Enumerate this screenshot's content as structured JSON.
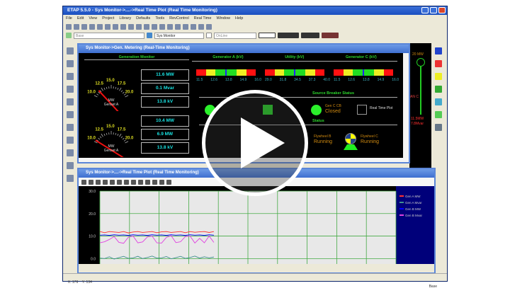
{
  "app": {
    "title": "ETAP 5.5.0 - Sys Monitor->....->Real Time Plot (Real Time Monitoring)",
    "menu": [
      "File",
      "Edit",
      "View",
      "Project",
      "Library",
      "Defaults",
      "Tools",
      "RevControl",
      "Real Time",
      "Window",
      "Help"
    ],
    "combos": {
      "revision": "Base",
      "study": "Sys Monitor",
      "mode": "OnLine"
    }
  },
  "metering": {
    "title": "Sys Monitor->Gen. Metering (Real-Time Monitoring)",
    "generation_monitor": "Generation Monitor",
    "gauges": [
      {
        "scale": [
          "10.0",
          "12.5",
          "15.0",
          "17.5",
          "20.0"
        ],
        "unit": "MW",
        "label": "Genset A",
        "value": 11.6
      },
      {
        "scale": [
          "10.0",
          "12.5",
          "15.0",
          "17.5",
          "20.0"
        ],
        "unit": "MW",
        "label": "Genset A",
        "value": 10.4
      }
    ],
    "readouts": [
      "11.6  MW",
      "0.1  Mvar",
      "13.8  kV",
      "10.4  MW",
      "6.9  MW",
      "13.8  kV"
    ],
    "bars": [
      {
        "title": "Generator A (kV)",
        "ticks": [
          "11.5",
          "12.6",
          "13.8",
          "14.9",
          "16.0"
        ]
      },
      {
        "title": "Utility (kV)",
        "ticks": [
          "29.0",
          "31.8",
          "34.5",
          "37.3",
          "40.0"
        ]
      },
      {
        "title": "Generator C (kV)",
        "ticks": [
          "11.5",
          "12.6",
          "13.8",
          "14.9",
          "16.0"
        ]
      }
    ],
    "breaker_status_title": "Source Breaker Status",
    "breaker_c": {
      "label": "Gen C CB",
      "state": "Closed"
    },
    "realtime_plot_label": "Real Time Plot",
    "status_title": "Status",
    "flywheel_b": {
      "label": "Flywheel B",
      "state": "Running"
    },
    "flywheel_c": {
      "label": "Flywheel C",
      "state": "Running"
    }
  },
  "schematic": {
    "gen": "20 MW",
    "gen_label": "Gen",
    "bus": "AN C",
    "mw": "11.5MW",
    "mvar": "7.8Mvar"
  },
  "plot": {
    "title": "Sys Monitor->....->Real Time Plot (Real Time Monitoring)",
    "chart_data": {
      "type": "line",
      "ylim": [
        -5,
        30
      ],
      "yticks": [
        "30.0",
        "20.0",
        "10.0",
        "0.0"
      ],
      "grid": true,
      "legend": "right",
      "series": [
        {
          "name": "Gen A MW",
          "color": "#ff3030",
          "values": [
            12,
            11.5,
            12,
            11.8,
            11.6,
            12,
            11.4,
            11.8,
            12,
            11.6,
            11.8,
            12,
            11.5,
            11.9,
            12,
            11.6,
            11.8,
            12,
            11.5,
            12,
            11.7,
            11.9,
            12,
            11.6,
            12
          ]
        },
        {
          "name": "Gen A Mvar",
          "color": "#409090",
          "values": [
            0.2,
            0,
            0.8,
            -0.2,
            0.4,
            1,
            0.1,
            0.3,
            1,
            0,
            0.5,
            1.1,
            0.2,
            0.3,
            0.9,
            -0.1,
            0.4,
            1,
            0.1,
            0.5,
            1.1,
            0.2,
            0.8,
            0.3,
            0.7
          ]
        },
        {
          "name": "Gen B MW",
          "color": "#0000ff",
          "values": [
            10.4,
            10.5,
            10.3,
            10.6,
            10.4,
            10.5,
            10.3,
            10.6,
            10.4,
            10.5,
            10.3,
            10.6,
            10.4,
            10.5,
            10.3,
            10.6,
            10.4,
            10.5,
            10.3,
            10.6,
            10.4,
            10.5,
            10.3,
            10.6,
            10.4
          ]
        },
        {
          "name": "Gen B Mvar",
          "color": "#e040e0",
          "values": [
            7,
            7.5,
            8.5,
            9.8,
            7.2,
            6.8,
            9.5,
            10,
            7,
            7.4,
            9.6,
            10,
            7,
            6.9,
            9.4,
            10.2,
            7.1,
            7.5,
            9.8,
            10,
            6.9,
            9,
            7,
            10,
            7.2
          ]
        }
      ]
    },
    "status_left": "X: 176    Y: 134",
    "status_right": "Base"
  }
}
